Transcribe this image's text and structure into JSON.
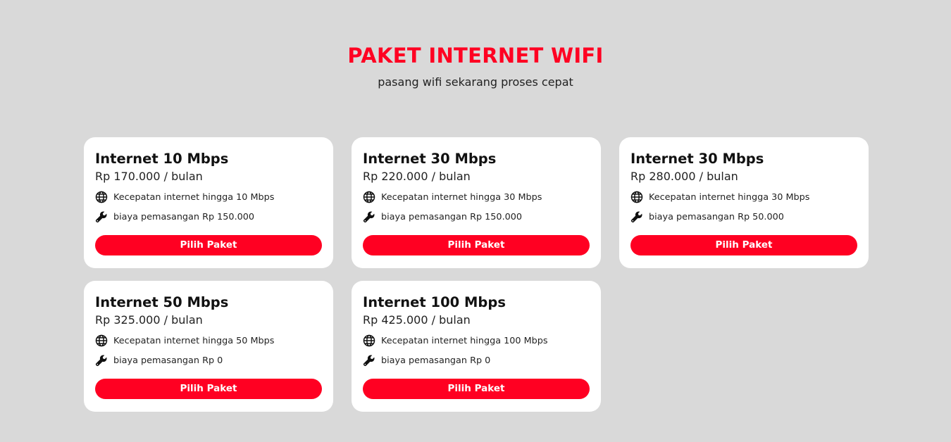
{
  "colors": {
    "background": "#d9d9d9",
    "accent": "#ff0022",
    "card": "#ffffff",
    "text": "#111111"
  },
  "header": {
    "title": "PAKET INTERNET WIFI",
    "subtitle": "pasang wifi sekarang proses cepat"
  },
  "icons": {
    "speed": "globe-icon",
    "install": "wrench-icon"
  },
  "packages": [
    {
      "name": "Internet 10 Mbps",
      "price": "Rp 170.000 / bulan",
      "speed_text": "Kecepatan internet hingga 10 Mbps",
      "install_text": "biaya pemasangan Rp 150.000",
      "button_label": "Pilih Paket"
    },
    {
      "name": "Internet 30 Mbps",
      "price": "Rp 220.000 / bulan",
      "speed_text": "Kecepatan internet hingga 30 Mbps",
      "install_text": "biaya pemasangan Rp 150.000",
      "button_label": "Pilih Paket"
    },
    {
      "name": "Internet 30 Mbps",
      "price": "Rp 280.000 / bulan",
      "speed_text": "Kecepatan internet hingga 30 Mbps",
      "install_text": "biaya pemasangan Rp 50.000",
      "button_label": "Pilih Paket"
    },
    {
      "name": "Internet 50 Mbps",
      "price": "Rp 325.000 / bulan",
      "speed_text": "Kecepatan internet hingga 50 Mbps",
      "install_text": "biaya pemasangan Rp 0",
      "button_label": "Pilih Paket"
    },
    {
      "name": "Internet 100 Mbps",
      "price": "Rp 425.000 / bulan",
      "speed_text": "Kecepatan internet hingga 100 Mbps",
      "install_text": "biaya pemasangan Rp 0",
      "button_label": "Pilih Paket"
    }
  ]
}
